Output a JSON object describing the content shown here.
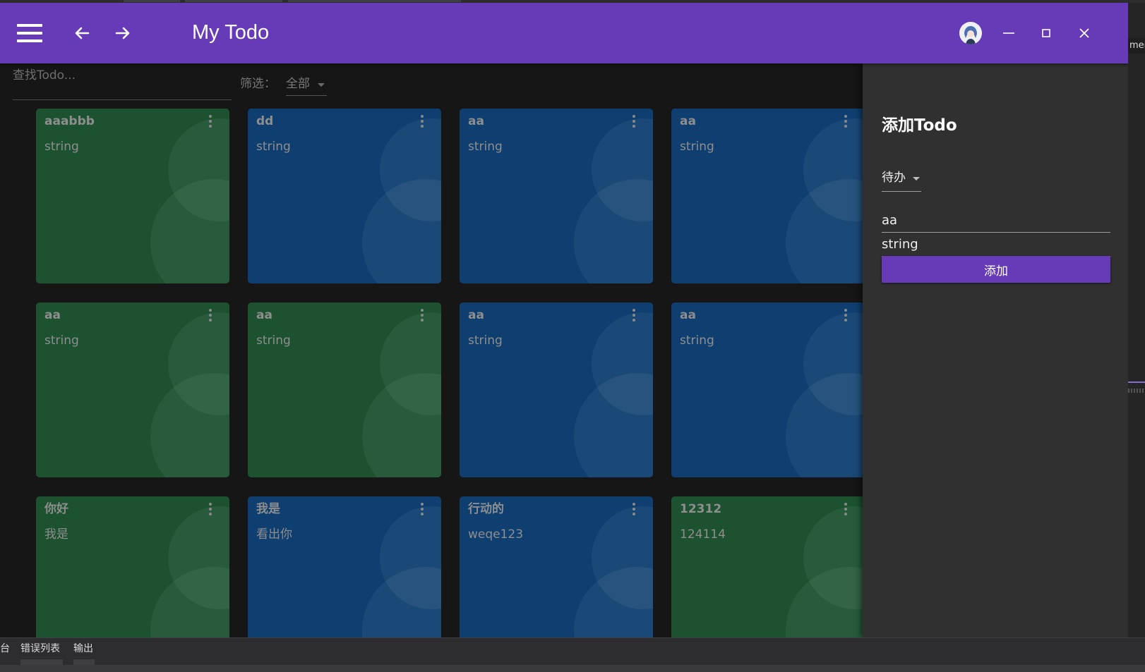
{
  "app": {
    "title": "My Todo",
    "accent_color": "#673ab7",
    "icons": {
      "menu": "hamburger-menu-icon",
      "back": "arrow-left-icon",
      "forward": "arrow-right-icon",
      "minimize": "minimize-icon",
      "maximize": "maximize-icon",
      "close": "close-icon"
    }
  },
  "search": {
    "placeholder": "查找Todo..."
  },
  "filter": {
    "label": "筛选：",
    "selected": "全部"
  },
  "todos": [
    {
      "title": "aaabbb",
      "content": "string",
      "color": "#1c5230"
    },
    {
      "title": "dd",
      "content": "string",
      "color": "#0e3f70"
    },
    {
      "title": "aa",
      "content": "string",
      "color": "#0e3f70"
    },
    {
      "title": "aa",
      "content": "string",
      "color": "#0e3f70"
    },
    {
      "title": "aa",
      "content": "string",
      "color": "#1c5230"
    },
    {
      "title": "aa",
      "content": "string",
      "color": "#1c5230"
    },
    {
      "title": "aa",
      "content": "string",
      "color": "#0e3f70"
    },
    {
      "title": "aa",
      "content": "string",
      "color": "#0e3f70"
    },
    {
      "title": "你好",
      "content": "我是",
      "color": "#1c5230"
    },
    {
      "title": "我是",
      "content": "看出你",
      "color": "#0e3f70"
    },
    {
      "title": "行动的",
      "content": "weqe123",
      "color": "#0e3f70"
    },
    {
      "title": "12312",
      "content": "124114",
      "color": "#1c5230"
    }
  ],
  "drawer": {
    "title": "添加Todo",
    "status_selected": "待办",
    "title_value": "aa",
    "content_value": "string",
    "add_label": "添加"
  },
  "ide": {
    "right_text": "mer",
    "bottom_tabs": [
      "台",
      "错误列表",
      "输出"
    ]
  }
}
